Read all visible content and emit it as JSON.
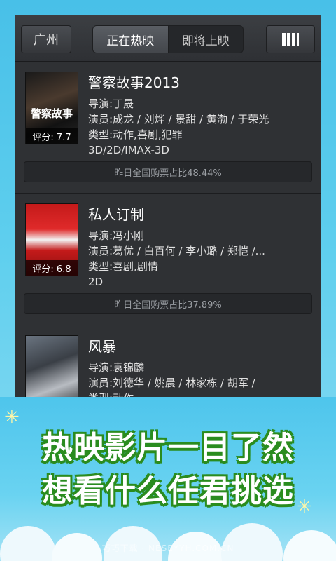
{
  "topbar": {
    "city": "广州",
    "tabs": [
      "正在热映",
      "即将上映"
    ],
    "active_tab": 0
  },
  "movies": [
    {
      "title": "警察故事2013",
      "director": "导演:丁晟",
      "cast": "演员:成龙 / 刘烨 / 景甜 / 黄渤 / 于荣光",
      "genre": "类型:动作,喜剧,犯罪",
      "format": "3D/2D/IMAX-3D",
      "score": "评分: 7.7",
      "share": "昨日全国购票占比48.44%",
      "poster_text": "警察故事"
    },
    {
      "title": "私人订制",
      "director": "导演:冯小刚",
      "cast": "演员:葛优 / 白百何 / 李小璐 / 郑恺 /...",
      "genre": "类型:喜剧,剧情",
      "format": "2D",
      "score": "评分: 6.8",
      "share": "昨日全国购票占比37.89%"
    },
    {
      "title": "风暴",
      "director": "导演:袁锦麟",
      "cast": "演员:刘德华 / 姚晨 / 林家栋 / 胡军 /",
      "genre": "类型:动作",
      "format": "",
      "score": "",
      "share": ""
    }
  ],
  "banner": {
    "line1": "热映影片一目了然",
    "line2": "想看什么任君挑选",
    "watermark": "巧巧下载 · NESEYYH.COM.CN"
  },
  "colors": {
    "list_bg": "#2f3134",
    "slogan_outline": "#2a8c1f",
    "sky": "#4ec5ec"
  }
}
